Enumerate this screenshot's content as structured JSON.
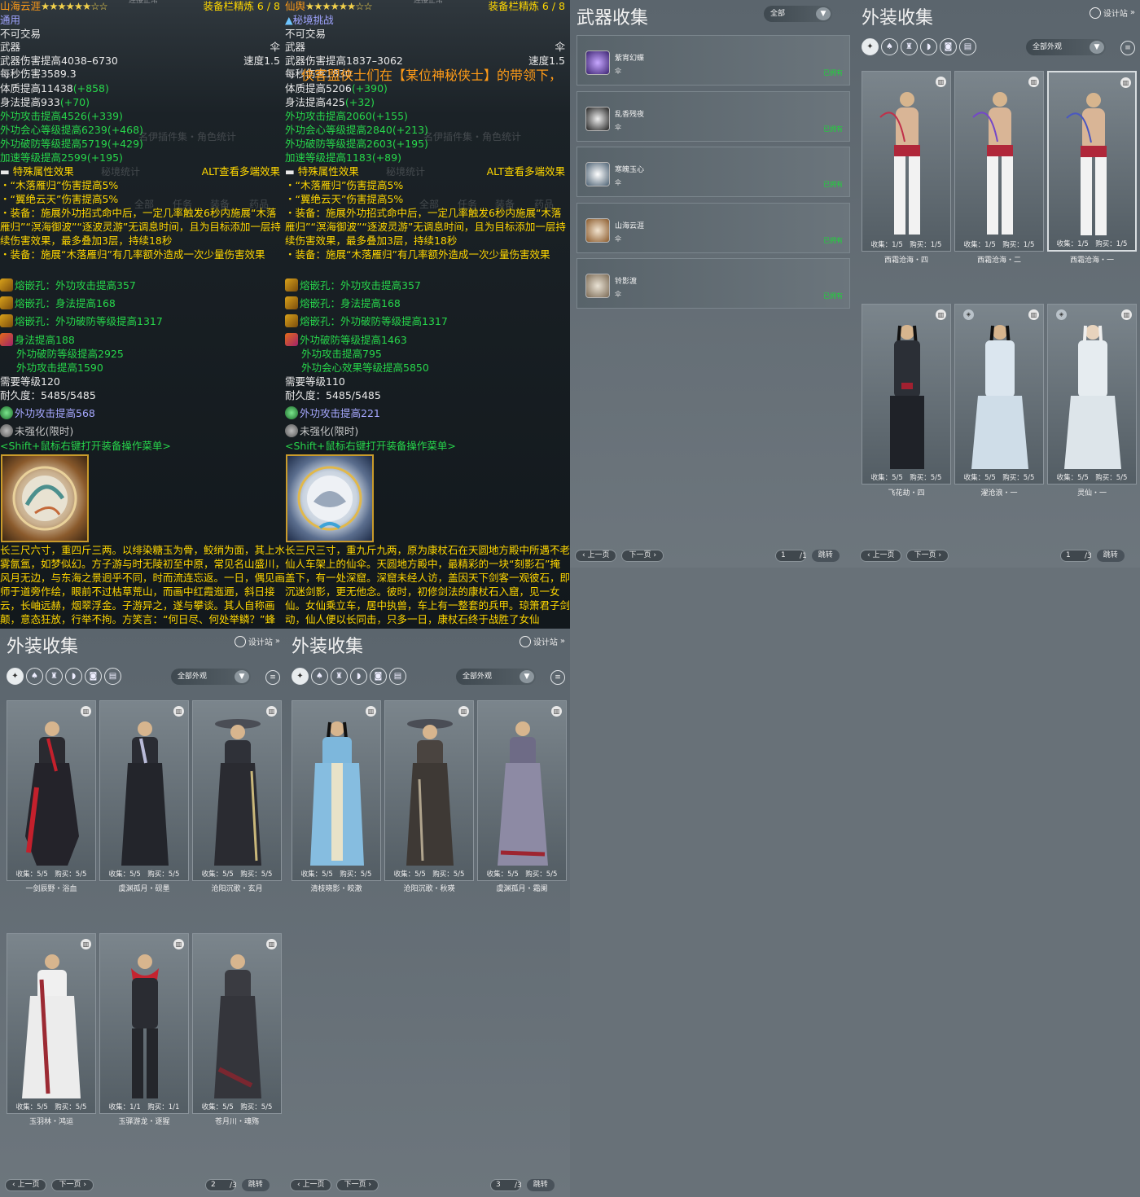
{
  "tip1": {
    "name": "山海云涯",
    "stars": "★★★★★★☆☆",
    "status": "连接正常",
    "refine": "装备栏精炼 6 / 8",
    "line2": "通用",
    "bind": "不可交易",
    "slot": "武器",
    "weapon_type": "伞",
    "dmg": "武器伤害提高4038–6730",
    "speed": "速度1.5",
    "dps": "每秒伤害3589.3",
    "attrs": [
      {
        "t": "体质提高11438",
        "b": "(+858)",
        "c": "wh"
      },
      {
        "t": "身法提高933",
        "b": "(+70)",
        "c": "wh"
      },
      {
        "t": "外功攻击提高4526",
        "b": "(+339)",
        "c": "g"
      },
      {
        "t": "外功会心等级提高6239",
        "b": "(+468)",
        "c": "g"
      },
      {
        "t": "外功破防等级提高5719",
        "b": "(+429)",
        "c": "g"
      },
      {
        "t": "加速等级提高2599",
        "b": "(+195)",
        "c": "g"
      }
    ],
    "special": "特殊属性效果",
    "alt": "ALT查看多端效果",
    "fx1": "・“木落雁归”伤害提高5%",
    "fx2": "・“翼绝云天”伤害提高5%",
    "fx3": "・装备：施展外功招式命中后，一定几率触发6秒内施展“木落雁归”“溟海御波”“逐波灵游”无调息时间，且为目标添加一层持续伤害效果，最多叠加3层，持续18秒",
    "fx4": "・装备：施展“木落雁归”有几率额外造成一次少量伤害效果",
    "sockets": [
      "熔嵌孔：外功攻击提高357",
      "熔嵌孔：身法提高168",
      "熔嵌孔：外功破防等级提高1317"
    ],
    "wuxing": [
      "身法提高188",
      "外功破防等级提高2925",
      "外功攻击提高1590"
    ],
    "level": "需要等级120",
    "dur": "耐久度：5485/5485",
    "gem": "外功攻击提高568",
    "enhance": "未强化(限时)",
    "shift": "<Shift+鼠标右键打开装备操作菜单>",
    "desc": "长三尺六寸，重四斤三两。以绯染糖玉为骨，鲛绡为面，其上水雾氤氲，如梦似幻。方子游与时无陵初至中原，常见名山盛川，风月无边，与东海之景迥乎不同，时而流连忘返。一日，偶见画师于道旁作绘，眼前不过枯草荒山，而画中红霞迤逦，斜日接云，长岫远赫，烟翠浮金。子游异之，遂与攀谈。其人自称画颠，意态狂放，行举不拘。方笑言：“何日尽、何处举鳞？”蜂",
    "ghosts": [
      "名伊插件集・角色统计",
      "秘境统计",
      "全部",
      "任务",
      "装备",
      "药品"
    ]
  },
  "tip2": {
    "name": "仙舆",
    "stars": "★★★★★★☆☆",
    "status": "连接正常",
    "refine": "装备栏精炼 6 / 8",
    "line2": "秘境挑战",
    "bind": "不可交易",
    "slot": "武器",
    "weapon_type": "伞",
    "dmg": "武器伤害提高1837–3062",
    "speed": "速度1.5",
    "dps": "每秒伤害1830",
    "banner": "侠客盟侠士们在【某位神秘侠士】的带领下，",
    "attrs": [
      {
        "t": "体质提高5206",
        "b": "(+390)",
        "c": "wh"
      },
      {
        "t": "身法提高425",
        "b": "(+32)",
        "c": "wh"
      },
      {
        "t": "外功攻击提高2060",
        "b": "(+155)",
        "c": "g"
      },
      {
        "t": "外功会心等级提高2840",
        "b": "(+213)",
        "c": "g"
      },
      {
        "t": "外功破防等级提高2603",
        "b": "(+195)",
        "c": "g"
      },
      {
        "t": "加速等级提高1183",
        "b": "(+89)",
        "c": "g"
      }
    ],
    "special": "特殊属性效果",
    "alt": "ALT查看多端效果",
    "fx1": "・“木落雁归”伤害提高5%",
    "fx2": "・“翼绝云天”伤害提高5%",
    "fx3": "・装备：施展外功招式命中后，一定几率触发6秒内施展“木落雁归”“溟海御波”“逐波灵游”无调息时间，且为目标添加一层持续伤害效果，最多叠加3层，持续18秒",
    "fx4": "・装备：施展“木落雁归”有几率额外造成一次少量伤害效果",
    "sockets": [
      "熔嵌孔：外功攻击提高357",
      "熔嵌孔：身法提高168",
      "熔嵌孔：外功破防等级提高1317"
    ],
    "wuxing": [
      "外功破防等级提高1463",
      "外功攻击提高795",
      "外功会心效果等级提高5850"
    ],
    "level": "需要等级110",
    "dur": "耐久度：5485/5485",
    "gem": "外功攻击提高221",
    "enhance": "未强化(限时)",
    "shift": "<Shift+鼠标右键打开装备操作菜单>",
    "desc": "长三尺三寸，重九斤九两，原为康杖石在天圆地方殿中所遇不老仙人车架上的仙伞。天圆地方殿中，最精彩的一块“刻影石”掩盖下，有一处深窟。深窟未经人访，盖因天下剑客一观彼石，即沉迷剑影，更无他念。彼时，初修剑法的康杖石入窟，见一女仙。女仙乘立车，居中执兽，车上有一整套的兵甲。琼箫君子剑动，仙人便以长同击，只多一日，康杖石终于战胜了女仙"
  },
  "weapons": {
    "title": "武器收集",
    "filter": "全部",
    "items": [
      {
        "name": "紫宵幻蝶",
        "type": "伞",
        "own": "已拥有"
      },
      {
        "name": "乱香残夜",
        "type": "伞",
        "own": "已拥有"
      },
      {
        "name": "寒魄玉心",
        "type": "伞",
        "own": "已拥有"
      },
      {
        "name": "山海云涯",
        "type": "伞",
        "own": "已拥有"
      },
      {
        "name": "铃影渡",
        "type": "伞",
        "own": "已拥有"
      }
    ],
    "prev": "上一页",
    "next": "下一页",
    "page": "1",
    "total": "/1",
    "jump": "跳转"
  },
  "outfit1": {
    "title": "外装收集",
    "designer": "设计站",
    "filter": "全部外观",
    "cards": [
      {
        "stat": "收集：1/5　购买：1/5",
        "name": "西霜沧海・四"
      },
      {
        "stat": "收集：1/5　购买：1/5",
        "name": "西霜沧海・二"
      },
      {
        "stat": "收集：1/5　购买：1/5",
        "name": "西霜沧海・一"
      },
      {
        "stat": "收集：5/5　购买：5/5",
        "name": "飞花劫・四"
      },
      {
        "stat": "收集：5/5　购买：5/5",
        "name": "濯沧浪・一"
      },
      {
        "stat": "收集：5/5　购买：5/5",
        "name": "灵仙・一"
      }
    ],
    "prev": "上一页",
    "next": "下一页",
    "page": "1",
    "total": "/3",
    "jump": "跳转"
  },
  "outfit2": {
    "title": "外装收集",
    "designer": "设计站",
    "filter": "全部外观",
    "cards": [
      {
        "stat": "收集：5/5　购买：5/5",
        "name": "一剑辰野・浴血"
      },
      {
        "stat": "收集：5/5　购买：5/5",
        "name": "虞渊孤月・砚墨"
      },
      {
        "stat": "收集：5/5　购买：5/5",
        "name": "沧阳沉歌・玄月"
      },
      {
        "stat": "收集：5/5　购买：5/5",
        "name": "玉羽林・鸿运"
      },
      {
        "stat": "收集：1/1　购买：1/1",
        "name": "玉驿游龙・逐猩"
      },
      {
        "stat": "收集：5/5　购买：5/5",
        "name": "苍月川・魂殇"
      }
    ],
    "prev": "上一页",
    "next": "下一页",
    "page": "2",
    "total": "/3",
    "jump": "跳转"
  },
  "outfit3": {
    "title": "外装收集",
    "designer": "设计站",
    "filter": "全部外观",
    "cards": [
      {
        "stat": "收集：5/5　购买：5/5",
        "name": "清枝晓影・皎澈"
      },
      {
        "stat": "收集：5/5　购买：5/5",
        "name": "沧阳沉歌・秋瑛"
      },
      {
        "stat": "收集：5/5　购买：5/5",
        "name": "虞渊孤月・霜阑"
      }
    ],
    "prev": "上一页",
    "next": "下一页",
    "page": "3",
    "total": "/3",
    "jump": "跳转"
  },
  "colors": {
    "gold": "#ffd700",
    "green": "#27d64b",
    "owned": "#1fd43a",
    "orange": "#ff9b17"
  }
}
